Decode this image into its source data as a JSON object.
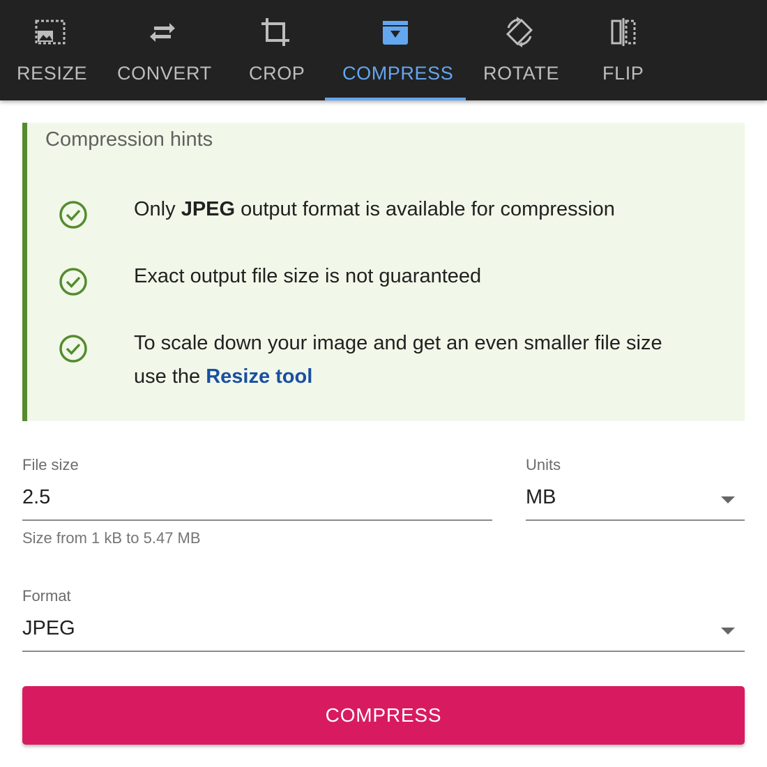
{
  "toolbar": {
    "tabs": [
      {
        "label": "RESIZE",
        "icon": "resize-icon",
        "active": false
      },
      {
        "label": "CONVERT",
        "icon": "convert-icon",
        "active": false
      },
      {
        "label": "CROP",
        "icon": "crop-icon",
        "active": false
      },
      {
        "label": "COMPRESS",
        "icon": "compress-icon",
        "active": true
      },
      {
        "label": "ROTATE",
        "icon": "rotate-icon",
        "active": false
      },
      {
        "label": "FLIP",
        "icon": "flip-icon",
        "active": false
      }
    ],
    "active_color": "#64a6f0",
    "background_color": "#222222"
  },
  "hints": {
    "title": "Compression hints",
    "icon": "check-circle-icon",
    "accent_color": "#558b2f",
    "items": [
      {
        "before": "Only ",
        "bold": "JPEG",
        "after": " output format is available for compression"
      },
      {
        "text": "Exact output file size is not guaranteed"
      },
      {
        "before": "To scale down your image and get an even smaller file size use the ",
        "link": "Resize tool"
      }
    ]
  },
  "form": {
    "file_size": {
      "label": "File size",
      "value": "2.5",
      "helper": "Size from 1 kB to 5.47 MB"
    },
    "units": {
      "label": "Units",
      "value": "MB"
    },
    "format": {
      "label": "Format",
      "value": "JPEG"
    }
  },
  "compress_button": {
    "label": "COMPRESS",
    "color": "#d81b60"
  }
}
